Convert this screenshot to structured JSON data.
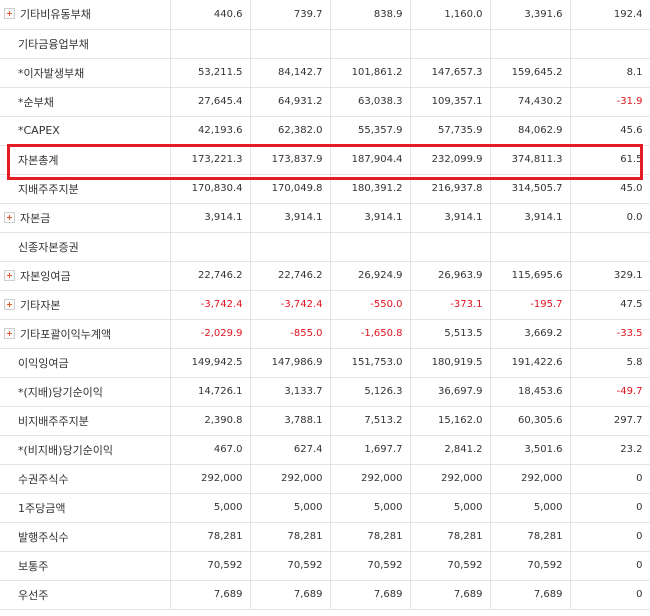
{
  "rows": [
    {
      "label": "기타비유동부채",
      "expandable": true,
      "values": [
        "440.6",
        "739.7",
        "838.9",
        "1,160.0",
        "3,391.6",
        "192.4"
      ]
    },
    {
      "label": "기타금융업부채",
      "expandable": false,
      "values": [
        "",
        "",
        "",
        "",
        "",
        ""
      ]
    },
    {
      "label": "*이자발생부채",
      "expandable": false,
      "values": [
        "53,211.5",
        "84,142.7",
        "101,861.2",
        "147,657.3",
        "159,645.2",
        "8.1"
      ]
    },
    {
      "label": "*순부채",
      "expandable": false,
      "values": [
        "27,645.4",
        "64,931.2",
        "63,038.3",
        "109,357.1",
        "74,430.2",
        "-31.9"
      ]
    },
    {
      "label": "*CAPEX",
      "expandable": false,
      "values": [
        "42,193.6",
        "62,382.0",
        "55,357.9",
        "57,735.9",
        "84,062.9",
        "45.6"
      ]
    },
    {
      "label": "자본총계",
      "expandable": false,
      "values": [
        "173,221.3",
        "173,837.9",
        "187,904.4",
        "232,099.9",
        "374,811.3",
        "61.5"
      ]
    },
    {
      "label": "지배주주지분",
      "expandable": false,
      "values": [
        "170,830.4",
        "170,049.8",
        "180,391.2",
        "216,937.8",
        "314,505.7",
        "45.0"
      ]
    },
    {
      "label": "자본금",
      "expandable": true,
      "values": [
        "3,914.1",
        "3,914.1",
        "3,914.1",
        "3,914.1",
        "3,914.1",
        "0.0"
      ]
    },
    {
      "label": "신종자본증권",
      "expandable": false,
      "values": [
        "",
        "",
        "",
        "",
        "",
        ""
      ]
    },
    {
      "label": "자본잉여금",
      "expandable": true,
      "values": [
        "22,746.2",
        "22,746.2",
        "26,924.9",
        "26,963.9",
        "115,695.6",
        "329.1"
      ]
    },
    {
      "label": "기타자본",
      "expandable": true,
      "values": [
        "-3,742.4",
        "-3,742.4",
        "-550.0",
        "-373.1",
        "-195.7",
        "47.5"
      ]
    },
    {
      "label": "기타포괄이익누계액",
      "expandable": true,
      "values": [
        "-2,029.9",
        "-855.0",
        "-1,650.8",
        "5,513.5",
        "3,669.2",
        "-33.5"
      ]
    },
    {
      "label": "이익잉여금",
      "expandable": false,
      "values": [
        "149,942.5",
        "147,986.9",
        "151,753.0",
        "180,919.5",
        "191,422.6",
        "5.8"
      ]
    },
    {
      "label": "*(지배)당기순이익",
      "expandable": false,
      "values": [
        "14,726.1",
        "3,133.7",
        "5,126.3",
        "36,697.9",
        "18,453.6",
        "-49.7"
      ]
    },
    {
      "label": "비지배주주지분",
      "expandable": false,
      "values": [
        "2,390.8",
        "3,788.1",
        "7,513.2",
        "15,162.0",
        "60,305.6",
        "297.7"
      ]
    },
    {
      "label": "*(비지배)당기순이익",
      "expandable": false,
      "values": [
        "467.0",
        "627.4",
        "1,697.7",
        "2,841.2",
        "3,501.6",
        "23.2"
      ]
    },
    {
      "label": "수권주식수",
      "expandable": false,
      "values": [
        "292,000",
        "292,000",
        "292,000",
        "292,000",
        "292,000",
        "0"
      ]
    },
    {
      "label": "1주당금액",
      "expandable": false,
      "values": [
        "5,000",
        "5,000",
        "5,000",
        "5,000",
        "5,000",
        "0"
      ]
    },
    {
      "label": "발행주식수",
      "expandable": false,
      "values": [
        "78,281",
        "78,281",
        "78,281",
        "78,281",
        "78,281",
        "0"
      ]
    },
    {
      "label": "보통주",
      "expandable": false,
      "values": [
        "70,592",
        "70,592",
        "70,592",
        "70,592",
        "70,592",
        "0"
      ]
    },
    {
      "label": "우선주",
      "expandable": false,
      "values": [
        "7,689",
        "7,689",
        "7,689",
        "7,689",
        "7,689",
        "0"
      ]
    }
  ],
  "highlighted_row_label": "자본총계",
  "colors": {
    "negative": "#e0141e",
    "highlight": "#e51c23",
    "expand_icon": "#e05a2a"
  }
}
